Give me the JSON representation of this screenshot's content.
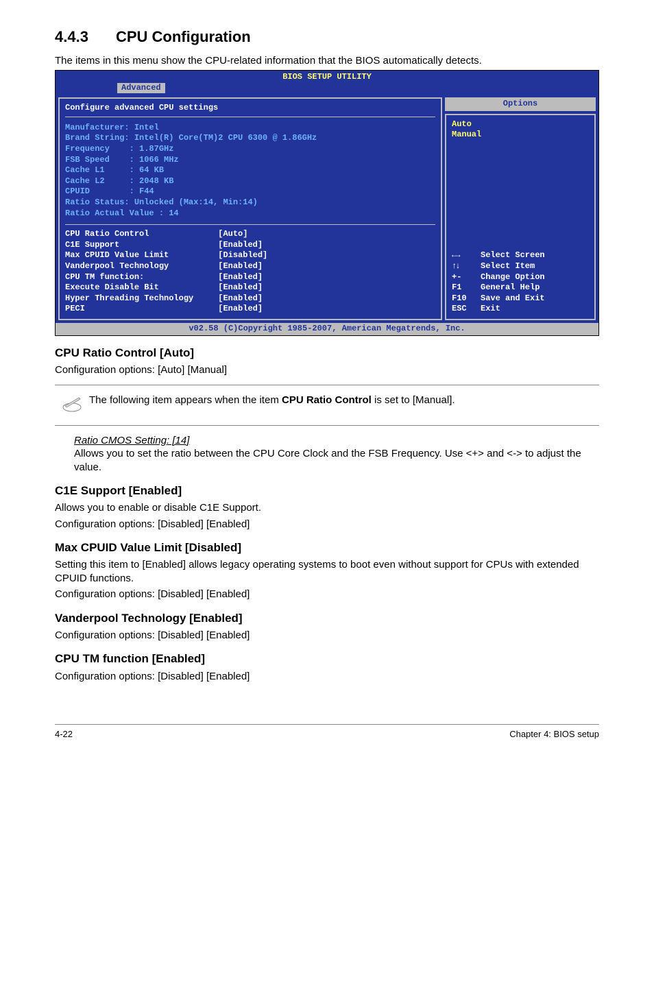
{
  "section": {
    "number": "4.4.3",
    "title": "CPU Configuration"
  },
  "intro": "The items in this menu show the CPU-related information that the BIOS automatically detects.",
  "bios": {
    "title": "BIOS SETUP UTILITY",
    "tab": "Advanced",
    "config_header": "Configure advanced CPU settings",
    "info": "Manufacturer: Intel\nBrand String: Intel(R) Core(TM)2 CPU 6300 @ 1.86GHz\nFrequency    : 1.87GHz\nFSB Speed    : 1066 MHz\nCache L1     : 64 KB\nCache L2     : 2048 KB\nCPUID        : F44\nRatio Status: Unlocked (Max:14, Min:14)\nRatio Actual Value : 14",
    "settings": "CPU Ratio Control              [Auto]\nC1E Support                    [Enabled]\nMax CPUID Value Limit          [Disabled]\nVanderpool Technology          [Enabled]\nCPU TM function:               [Enabled]\nExecute Disable Bit            [Enabled]\nHyper Threading Technology     [Enabled]\nPECI                           [Enabled]",
    "options_header": "Options",
    "options_body": "Auto\nManual",
    "help": [
      {
        "key": "←→",
        "text": "Select Screen"
      },
      {
        "key": "↑↓",
        "text": "Select Item"
      },
      {
        "key": "+-",
        "text": "Change Option"
      },
      {
        "key": "F1",
        "text": "General Help"
      },
      {
        "key": "F10",
        "text": "Save and Exit"
      },
      {
        "key": "ESC",
        "text": "Exit"
      }
    ],
    "footer": "v02.58 (C)Copyright 1985-2007, American Megatrends, Inc."
  },
  "sections": {
    "cpu_ratio": {
      "heading": "CPU Ratio Control [Auto]",
      "body": "Configuration options: [Auto] [Manual]"
    },
    "note": {
      "text_prefix": "The following item appears when the item ",
      "bold": "CPU Ratio Control",
      "text_suffix": " is set to [Manual]."
    },
    "ratio_cmos": {
      "heading": "Ratio CMOS Setting: [14]",
      "body": "Allows you to set the ratio between the CPU Core Clock and the FSB Frequency. Use <+> and <-> to adjust the value."
    },
    "c1e": {
      "heading": "C1E Support [Enabled]",
      "body1": "Allows you to enable or disable C1E Support.",
      "body2": "Configuration options: [Disabled] [Enabled]"
    },
    "max_cpuid": {
      "heading": "Max CPUID Value Limit [Disabled]",
      "body1": "Setting this item to [Enabled] allows legacy operating systems to boot even without support for CPUs with extended CPUID functions.",
      "body2": "Configuration options: [Disabled] [Enabled]"
    },
    "vanderpool": {
      "heading": "Vanderpool Technology [Enabled]",
      "body": "Configuration options: [Disabled] [Enabled]"
    },
    "cpu_tm": {
      "heading": "CPU TM function [Enabled]",
      "body": "Configuration options: [Disabled] [Enabled]"
    }
  },
  "footer": {
    "left": "4-22",
    "right": "Chapter 4: BIOS setup"
  }
}
